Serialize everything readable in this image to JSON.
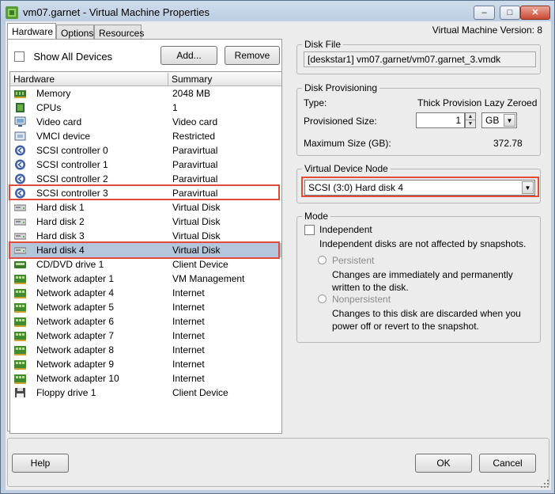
{
  "window": {
    "title": "vm07.garnet - Virtual Machine Properties",
    "minimize_glyph": "–",
    "maximize_glyph": "□",
    "close_glyph": "✕"
  },
  "tabs": [
    {
      "label": "Hardware",
      "active": true
    },
    {
      "label": "Options",
      "active": false
    },
    {
      "label": "Resources",
      "active": false
    }
  ],
  "vm_version": "Virtual Machine Version: 8",
  "left": {
    "show_all_label": "Show All Devices",
    "add_button": "Add...",
    "remove_button": "Remove",
    "columns": {
      "hardware": "Hardware",
      "summary": "Summary"
    },
    "rows": [
      {
        "name": "Memory",
        "summary": "2048 MB",
        "icon": "memory-icon"
      },
      {
        "name": "CPUs",
        "summary": "1",
        "icon": "cpu-icon"
      },
      {
        "name": "Video card",
        "summary": "Video card",
        "icon": "monitor-icon"
      },
      {
        "name": "VMCI device",
        "summary": "Restricted",
        "icon": "vmci-icon"
      },
      {
        "name": "SCSI controller 0",
        "summary": "Paravirtual",
        "icon": "scsi-controller-icon"
      },
      {
        "name": "SCSI controller 1",
        "summary": "Paravirtual",
        "icon": "scsi-controller-icon"
      },
      {
        "name": "SCSI controller 2",
        "summary": "Paravirtual",
        "icon": "scsi-controller-icon"
      },
      {
        "name": "SCSI controller 3",
        "summary": "Paravirtual",
        "icon": "scsi-controller-icon"
      },
      {
        "name": "Hard disk 1",
        "summary": "Virtual Disk",
        "icon": "hard-disk-icon"
      },
      {
        "name": "Hard disk 2",
        "summary": "Virtual Disk",
        "icon": "hard-disk-icon"
      },
      {
        "name": "Hard disk 3",
        "summary": "Virtual Disk",
        "icon": "hard-disk-icon"
      },
      {
        "name": "Hard disk 4",
        "summary": "Virtual Disk",
        "icon": "hard-disk-icon"
      },
      {
        "name": "CD/DVD drive 1",
        "summary": "Client Device",
        "icon": "cd-dvd-icon"
      },
      {
        "name": "Network adapter 1",
        "summary": "VM Management",
        "icon": "network-adapter-icon"
      },
      {
        "name": "Network adapter 4",
        "summary": "Internet",
        "icon": "network-adapter-icon"
      },
      {
        "name": "Network adapter 5",
        "summary": "Internet",
        "icon": "network-adapter-icon"
      },
      {
        "name": "Network adapter 6",
        "summary": "Internet",
        "icon": "network-adapter-icon"
      },
      {
        "name": "Network adapter 7",
        "summary": "Internet",
        "icon": "network-adapter-icon"
      },
      {
        "name": "Network adapter 8",
        "summary": "Internet",
        "icon": "network-adapter-icon"
      },
      {
        "name": "Network adapter 9",
        "summary": "Internet",
        "icon": "network-adapter-icon"
      },
      {
        "name": "Network adapter 10",
        "summary": "Internet",
        "icon": "network-adapter-icon"
      },
      {
        "name": "Floppy drive 1",
        "summary": "Client Device",
        "icon": "floppy-icon"
      }
    ],
    "selected_row": "Hard disk 4",
    "highlighted_rows": [
      "SCSI controller 3",
      "Hard disk 4"
    ]
  },
  "disk_file": {
    "title": "Disk File",
    "value": "[deskstar1] vm07.garnet/vm07.garnet_3.vmdk"
  },
  "provisioning": {
    "title": "Disk Provisioning",
    "type_label": "Type:",
    "type_value": "Thick Provision Lazy Zeroed",
    "size_label": "Provisioned Size:",
    "size_value": "1",
    "unit": "GB",
    "max_label": "Maximum Size (GB):",
    "max_value": "372.78"
  },
  "device_node": {
    "title": "Virtual Device Node",
    "value": "SCSI (3:0) Hard disk 4"
  },
  "mode": {
    "title": "Mode",
    "independent_label": "Independent",
    "independent_desc": "Independent disks are not affected by snapshots.",
    "persistent_label": "Persistent",
    "persistent_desc": "Changes are immediately and permanently written to the disk.",
    "nonpersistent_label": "Nonpersistent",
    "nonpersistent_desc": "Changes to this disk are discarded when you power off or revert to the snapshot."
  },
  "footer": {
    "help": "Help",
    "ok": "OK",
    "cancel": "Cancel"
  },
  "colors": {
    "highlight": "#e04a3f",
    "selection": "#b4c6dc"
  }
}
